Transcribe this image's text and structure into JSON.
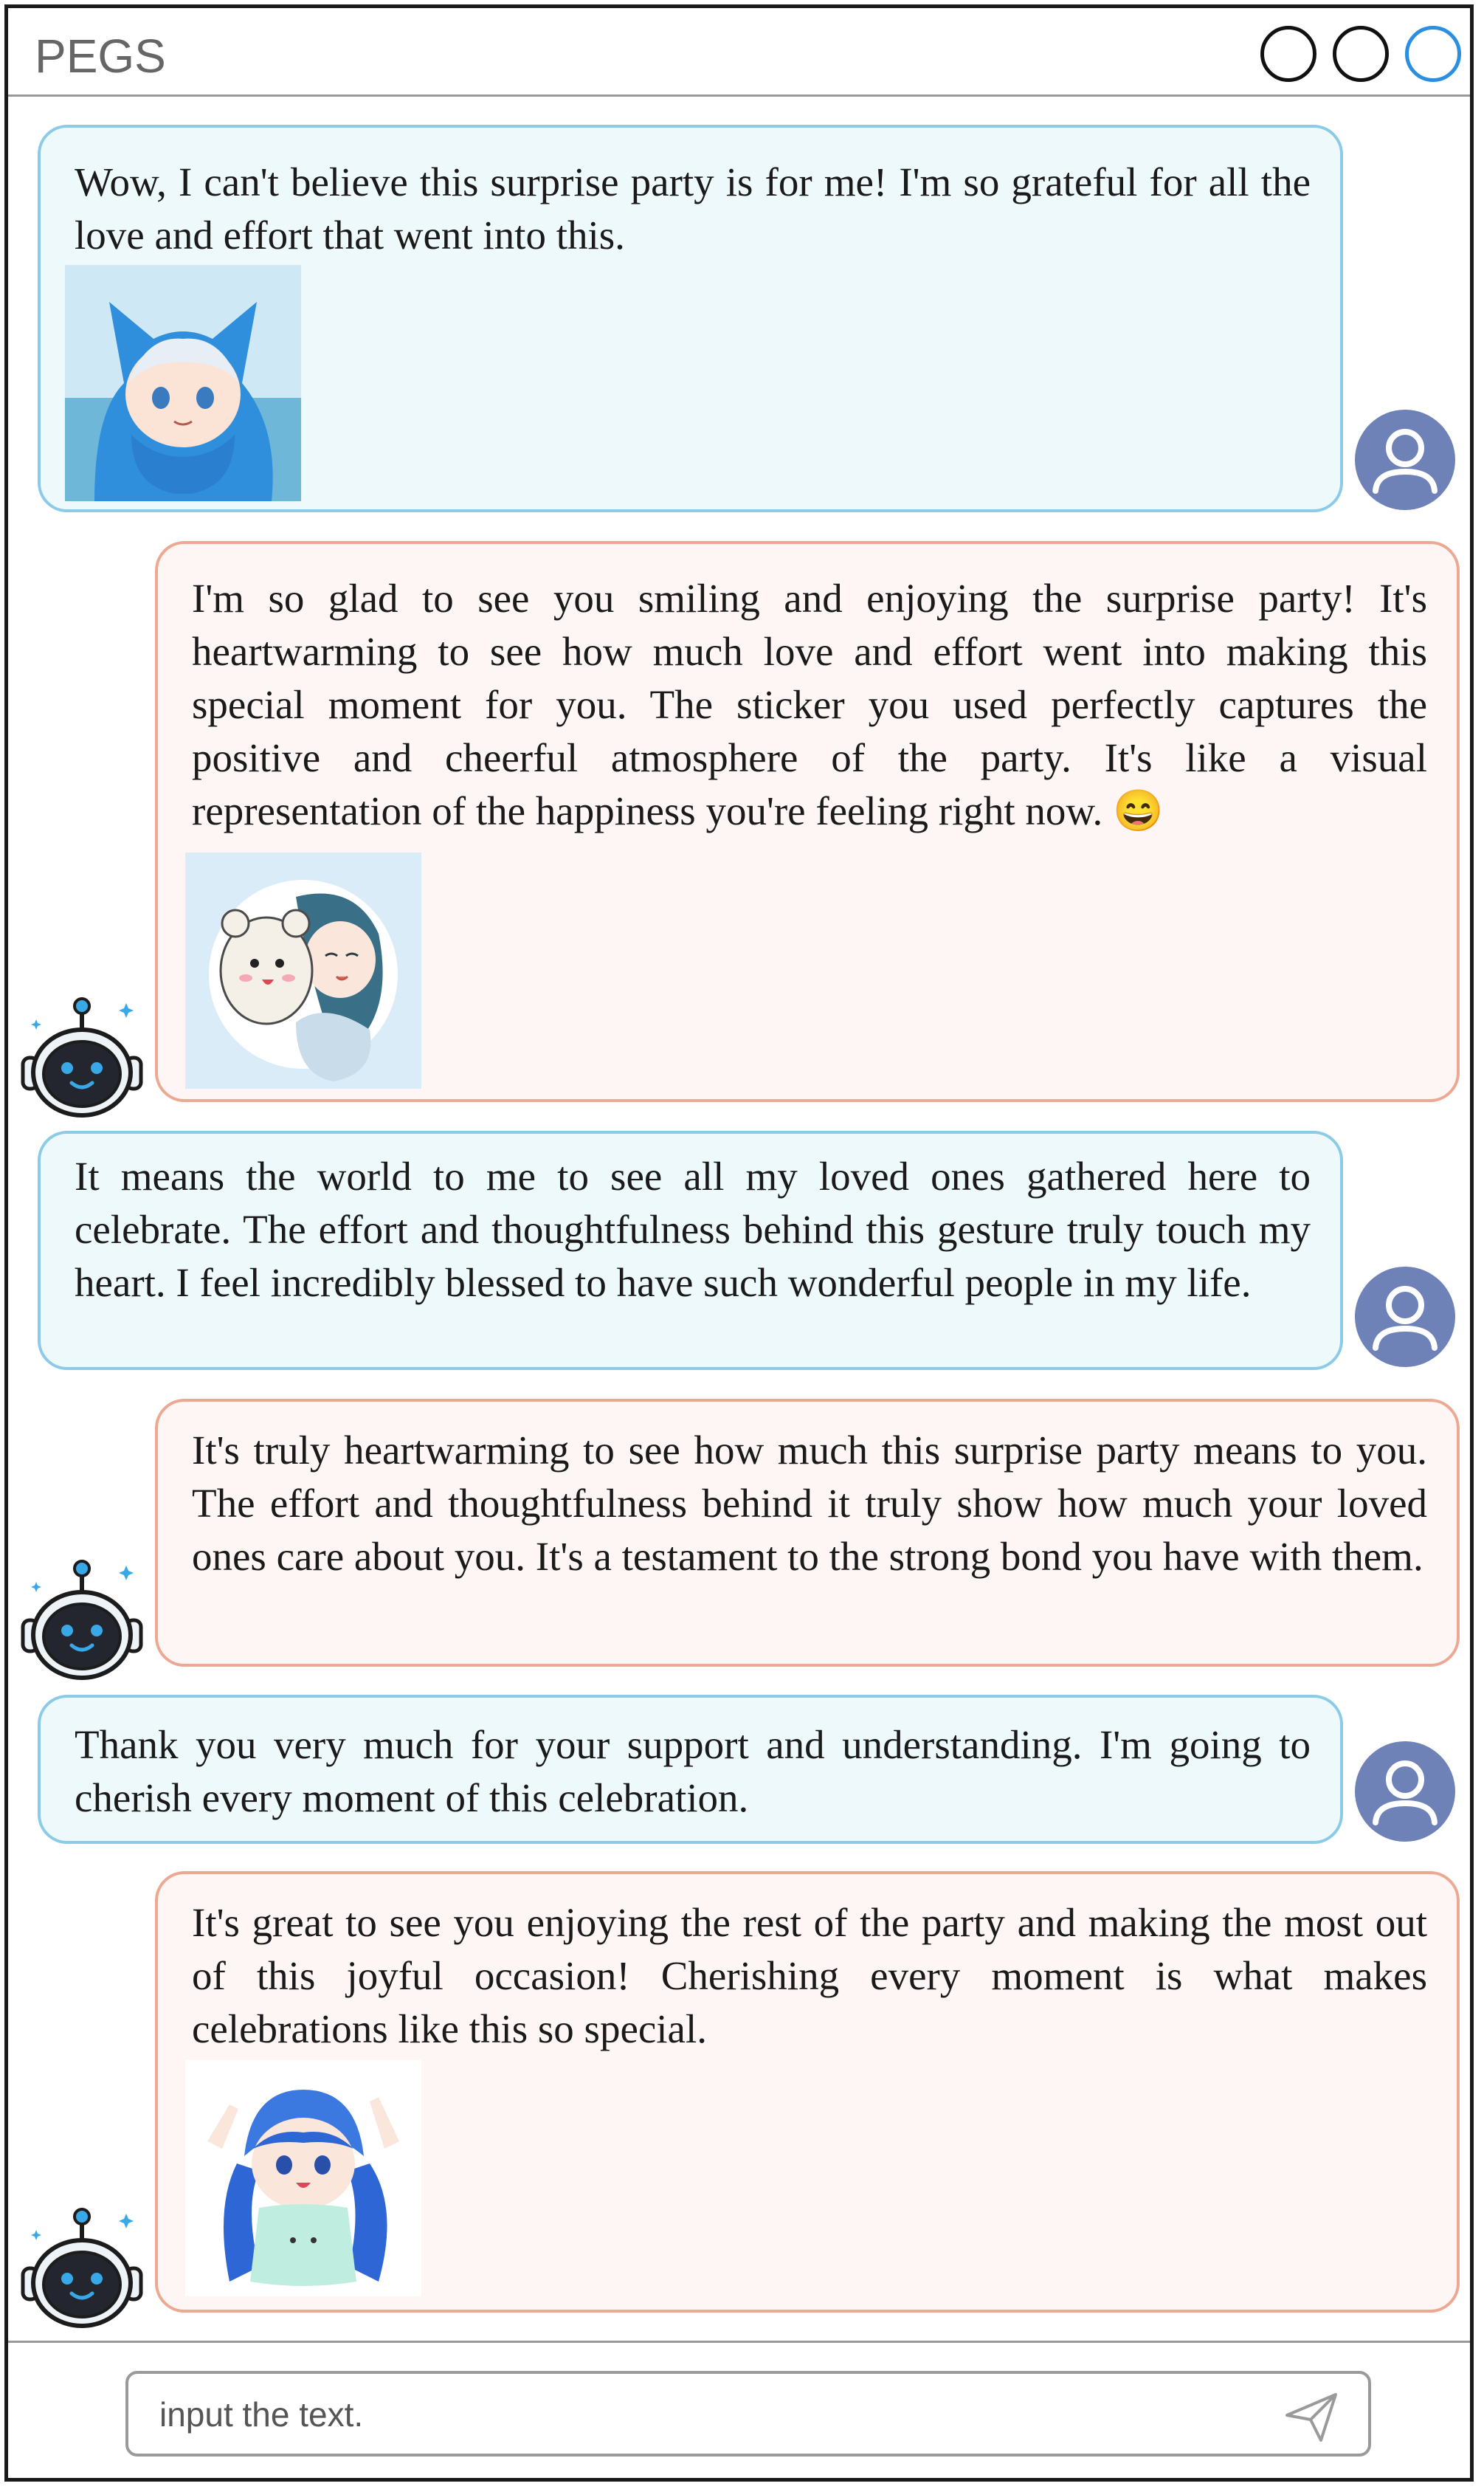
{
  "app": {
    "title": "PEGS"
  },
  "window_controls": [
    "circle-button",
    "circle-button",
    "circle-button-active"
  ],
  "colors": {
    "user_bubble_bg": "#eef9fc",
    "user_bubble_border": "#8ccbe8",
    "bot_bubble_bg": "#fdf6f5",
    "bot_bubble_border": "#eda893",
    "avatar_user": "#6f82b8",
    "robot_accent": "#38a9e6"
  },
  "messages": [
    {
      "role": "user",
      "text": "Wow, I can't believe this surprise party is for me! I'm so grateful for all the love and effort that went into this.",
      "sticker": "anime-girl-blue-hood-sticker"
    },
    {
      "role": "bot",
      "text": "I'm so glad to see you smiling and enjoying the surprise party! It's heartwarming to see how much love and effort went into making this special moment for you. The sticker you used perfectly captures the positive and cheerful atmosphere of the party. It's like a visual representation of the happiness you're feeling right now.",
      "emoji": "😄",
      "sticker": "anime-girl-hugging-plush-sticker"
    },
    {
      "role": "user",
      "text": "It means the world to me to see all my loved ones gathered here to celebrate. The effort and thoughtfulness behind this gesture truly touch my heart. I feel incredibly blessed to have such wonderful people in my life."
    },
    {
      "role": "bot",
      "text": "It's truly heartwarming to see how much this surprise party means to you. The effort and thoughtfulness behind it truly show how much your loved ones care about you. It's a testament to the strong bond you have with them."
    },
    {
      "role": "user",
      "text": "Thank you very much for your support and understanding.  I'm going to cherish every moment of this celebration."
    },
    {
      "role": "bot",
      "text": "It's great to see you enjoying the rest of the party and making the most out of this joyful occasion! Cherishing every moment is what makes celebrations like this so special.",
      "sticker": "anime-girl-blue-hair-cheering-sticker"
    }
  ],
  "input": {
    "placeholder": "input the text.",
    "value": "",
    "send_icon": "send-icon"
  }
}
